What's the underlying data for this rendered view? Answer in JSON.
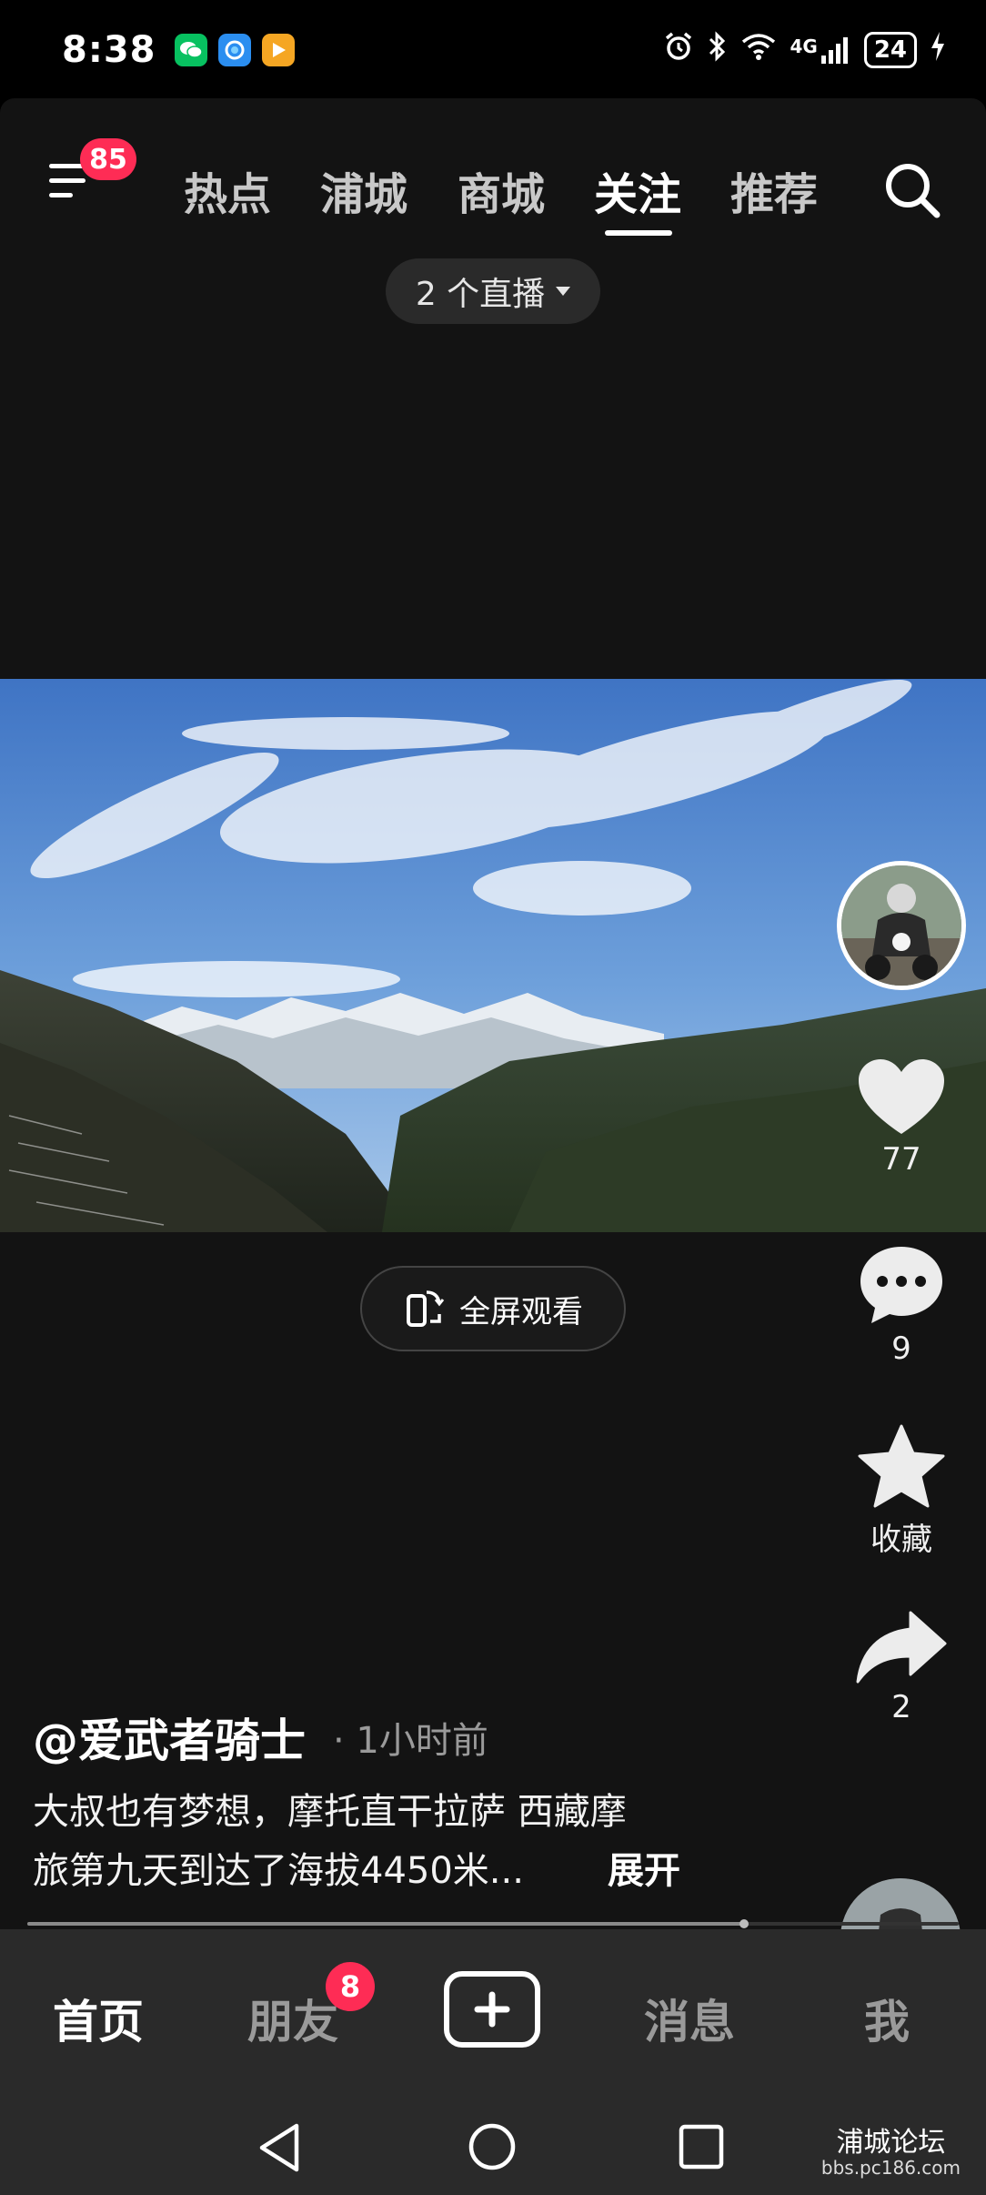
{
  "status_bar": {
    "time": "8:38",
    "network": "4G",
    "battery": "24",
    "apps": [
      {
        "icon": "wechat-icon",
        "color": "#07c160"
      },
      {
        "icon": "browser-icon",
        "color": "#2b8ef0"
      },
      {
        "icon": "video-app-icon",
        "color": "#f5a623"
      }
    ]
  },
  "header": {
    "menu_badge": "85",
    "tabs": [
      "热点",
      "浦城",
      "商城",
      "关注",
      "推荐"
    ],
    "active_tab": "关注"
  },
  "live_pill": {
    "label": "2 个直播"
  },
  "video": {
    "fullscreen_label": "全屏观看"
  },
  "actions": {
    "likes": "77",
    "comments": "9",
    "favorite_label": "收藏",
    "shares": "2"
  },
  "post": {
    "author": "@爱武者骑士",
    "time": "· 1小时前",
    "caption_line1": "大叔也有梦想，摩托直干拉萨 西藏摩",
    "caption_line2": "旅第九天到达了海拔4450米...",
    "expand_label": "展开",
    "progress": 0.77
  },
  "bottom_nav": {
    "home": "首页",
    "friends": "朋友",
    "friends_badge": "8",
    "messages": "消息",
    "me": "我"
  },
  "watermark": {
    "title": "浦城论坛",
    "url": "bbs.pc186.com"
  },
  "colors": {
    "accent": "#fe2c55",
    "background": "#131313",
    "bar": "#2a2a2a"
  }
}
